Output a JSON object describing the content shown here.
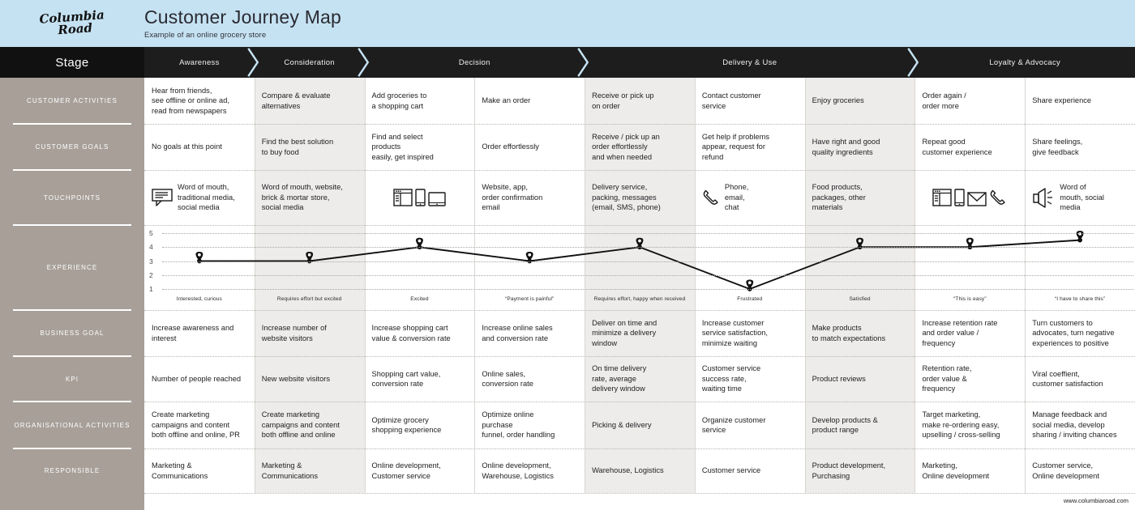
{
  "header": {
    "logo_line1": "Columbia",
    "logo_line2": "Road",
    "title": "Customer Journey Map",
    "subtitle": "Example of an online grocery store"
  },
  "stage_header": {
    "label": "Stage",
    "stages": [
      {
        "name": "Awareness",
        "start_col": 0,
        "span": 1
      },
      {
        "name": "Consideration",
        "start_col": 1,
        "span": 1
      },
      {
        "name": "Decision",
        "start_col": 2,
        "span": 2
      },
      {
        "name": "Delivery & Use",
        "start_col": 4,
        "span": 3
      },
      {
        "name": "Loyalty & Advocacy",
        "start_col": 7,
        "span": 2
      }
    ]
  },
  "sidebar": {
    "rows": [
      "CUSTOMER ACTIVITIES",
      "CUSTOMER GOALS",
      "TOUCHPOINTS",
      "EXPERIENCE",
      "BUSINESS GOAL",
      "KPI",
      "ORGANISATIONAL ACTIVITIES",
      "RESPONSIBLE"
    ]
  },
  "columns": [
    {
      "index": 0,
      "shaded": false
    },
    {
      "index": 1,
      "shaded": true
    },
    {
      "index": 2,
      "shaded": false
    },
    {
      "index": 3,
      "shaded": false
    },
    {
      "index": 4,
      "shaded": true
    },
    {
      "index": 5,
      "shaded": false
    },
    {
      "index": 6,
      "shaded": true
    },
    {
      "index": 7,
      "shaded": false
    },
    {
      "index": 8,
      "shaded": false
    }
  ],
  "rows": {
    "customer_activities": [
      "Hear from friends,\nsee offline or online ad,\nread from newspapers",
      "Compare & evaluate\nalternatives",
      "Add groceries to\na shopping cart",
      "Make an order",
      "Receive or pick up\non order",
      "Contact customer\nservice",
      "Enjoy groceries",
      "Order again /\norder more",
      "Share experience"
    ],
    "customer_goals": [
      "No goals at this point",
      "Find the best solution\nto buy food",
      "Find and select\nproducts\neasily, get inspired",
      "Order effortlessly",
      "Receive / pick up an\norder effortlessly\nand when needed",
      "Get help if problems\nappear, request for\nrefund",
      "Have right and good\nquality ingredients",
      "Repeat good\ncustomer experience",
      "Share feelings,\ngive feedback"
    ],
    "touchpoints": [
      {
        "icons": [
          "speech-bubble-icon"
        ],
        "text": "Word of mouth,\ntraditional media,\nsocial media"
      },
      {
        "icons": [],
        "text": "Word of mouth, website,\nbrick & mortar store,\nsocial media"
      },
      {
        "icons": [
          "browser-window-icon",
          "smartphone-icon",
          "tablet-icon"
        ],
        "text": ""
      },
      {
        "icons": [],
        "text": "Website, app,\norder confirmation\nemail"
      },
      {
        "icons": [],
        "text": "Delivery service,\npacking, messages\n(email, SMS, phone)"
      },
      {
        "icons": [
          "phone-handset-icon"
        ],
        "text": "Phone,\nemail,\nchat"
      },
      {
        "icons": [],
        "text": "Food products,\npackages, other\nmaterials"
      },
      {
        "icons": [
          "browser-window-icon",
          "smartphone-icon",
          "envelope-icon",
          "phone-handset-icon"
        ],
        "text": ""
      },
      {
        "icons": [
          "megaphone-icon"
        ],
        "text": "Word of\nmouth, social\nmedia"
      }
    ],
    "business_goal": [
      "Increase awareness and\ninterest",
      "Increase number of\nwebsite visitors",
      "Increase shopping cart\nvalue & conversion rate",
      "Increase online sales\nand conversion rate",
      "Deliver on time and\nminimize a delivery\nwindow",
      "Increase customer\nservice satisfaction,\nminimize waiting",
      "Make products\nto match expectations",
      "Increase retention rate\nand order value /\nfrequency",
      "Turn customers to\nadvocates, turn negative\nexperiences to positive"
    ],
    "kpi": [
      "Number of people reached",
      "New website visitors",
      "Shopping cart value,\nconversion rate",
      "Online sales,\nconversion rate",
      "On time delivery\nrate, average\ndelivery window",
      "Customer service\nsuccess rate,\nwaiting time",
      "Product reviews",
      "Retention rate,\norder value &\nfrequency",
      "Viral coeffient,\ncustomer satisfaction"
    ],
    "organisational_activities": [
      "Create marketing\ncampaigns and content\nboth offline and online, PR",
      "Create marketing\ncampaigns and content\nboth offline and online",
      "Optimize grocery\nshopping experience",
      "Optimize online\npurchase\nfunnel, order handling",
      "Picking & delivery",
      "Organize customer\nservice",
      "Develop products &\nproduct range",
      "Target marketing,\nmake re-ordering easy,\nupselling / cross-selling",
      "Manage feedback and\nsocial media, develop\nsharing / inviting chances"
    ],
    "responsible": [
      "Marketing &\nCommunications",
      "Marketing &\nCommunications",
      "Online development,\nCustomer service",
      "Online development,\nWarehouse, Logistics",
      "Warehouse, Logistics",
      "Customer service",
      "Product development,\nPurchasing",
      "Marketing,\nOnline development",
      "Customer service,\nOnline development"
    ]
  },
  "chart_data": {
    "type": "line",
    "title": "Experience",
    "ylabel": "",
    "xlabel": "",
    "ylim": [
      1,
      5
    ],
    "yticks": [
      "1",
      "2",
      "3",
      "4",
      "5"
    ],
    "grid": true,
    "categories": [
      "Awareness",
      "Consideration",
      "Decision",
      "Payment",
      "Receive",
      "Customer service",
      "Enjoy",
      "Order again",
      "Share"
    ],
    "values": [
      3,
      3,
      4,
      3,
      4,
      1,
      4,
      4,
      4.5
    ],
    "annotations": [
      "Interested, curious",
      "Requires effort but excited",
      "Excited",
      "“Payment is painful”",
      "Requires effort, happy when received",
      "Frustrated",
      "Satisfied",
      "“This is easy”",
      "“I have to share this”"
    ],
    "marker": "map-pin",
    "line_color": "#111111"
  },
  "footer": {
    "url": "www.columbiaroad.com"
  },
  "colors": {
    "header_bg": "#c5e2f2",
    "stage_bg": "#1d1d1d",
    "sidebar_bg": "#a79f98",
    "shaded_col": "#edecea",
    "plain_col": "#ffffff",
    "text": "#1e1e22"
  }
}
